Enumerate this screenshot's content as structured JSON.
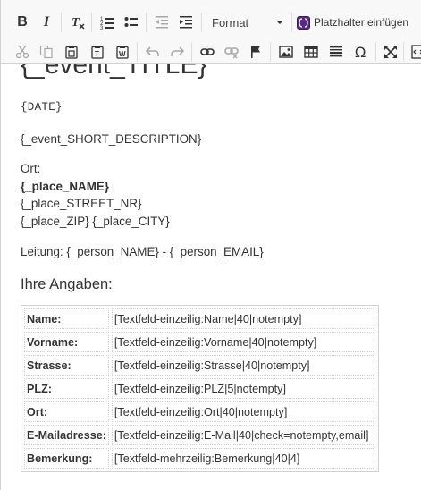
{
  "toolbar": {
    "format_label": "Format",
    "placeholder_button_label": "Platzhalter einfügen",
    "placeholder_icon_color": "#5b2a86",
    "row1_icons": [
      "bold-icon",
      "italic-icon",
      "remove-format-icon",
      "numbered-list-icon",
      "bulleted-list-icon",
      "outdent-icon",
      "indent-icon"
    ],
    "row2_icons": [
      "cut-icon",
      "copy-icon",
      "paste-icon",
      "paste-text-icon",
      "paste-from-word-icon",
      "undo-icon",
      "redo-icon",
      "link-icon",
      "unlink-icon",
      "anchor-icon",
      "image-icon",
      "table-icon",
      "horizontal-line-icon",
      "special-char-icon",
      "maximize-icon",
      "source-icon"
    ]
  },
  "content": {
    "event_title": "{_event_TITLE}",
    "date": "{DATE}",
    "short_description": "{_event_SHORT_DESCRIPTION}",
    "ort_label": "Ort:",
    "place_name": "{_place_NAME}",
    "place_street": "{_place_STREET_NR}",
    "place_zip_city": "{_place_ZIP} {_place_CITY}",
    "leitung": "Leitung: {_person_NAME} - {_person_EMAIL}",
    "ihre_angaben": "Ihre Angaben:",
    "form_rows": [
      {
        "label": "Name:",
        "value": "[Textfeld-einzeilig:Name|40|notempty]"
      },
      {
        "label": "Vorname:",
        "value": "[Textfeld-einzeilig:Vorname|40|notempty]"
      },
      {
        "label": "Strasse:",
        "value": "[Textfeld-einzeilig:Strasse|40|notempty]"
      },
      {
        "label": "PLZ:",
        "value": "[Textfeld-einzeilig:PLZ|5|notempty]"
      },
      {
        "label": "Ort:",
        "value": "[Textfeld-einzeilig:Ort|40|notempty]"
      },
      {
        "label": "E-Mailadresse:",
        "value": "[Textfeld-einzeilig:E-Mail|40|check=notempty,email]"
      },
      {
        "label": "Bemerkung:",
        "value": "[Textfeld-mehrzeilig:Bemerkung|40|4]"
      }
    ]
  }
}
